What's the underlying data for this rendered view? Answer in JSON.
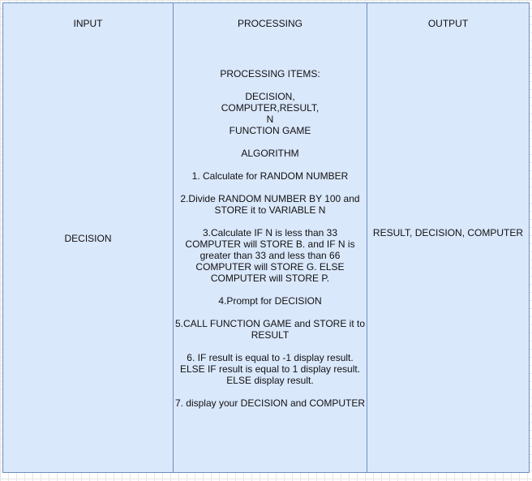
{
  "headers": {
    "input": "INPUT",
    "processing": "PROCESSING",
    "output": "OUTPUT"
  },
  "input": {
    "text": "DECISION"
  },
  "output": {
    "text": "RESULT, DECISION, COMPUTER"
  },
  "processing": {
    "lines": [
      "PROCESSING ITEMS:",
      "",
      "DECISION,",
      "COMPUTER,RESULT,",
      "N",
      "FUNCTION GAME",
      "",
      "ALGORITHM",
      "",
      "1. Calculate for RANDOM NUMBER",
      "",
      "2.Divide RANDOM NUMBER BY 100 and",
      "STORE it to VARIABLE N",
      "",
      "3.Calculate IF N is less than 33",
      "COMPUTER will STORE B. and IF N is",
      "greater than 33 and less than 66",
      "COMPUTER will STORE G. ELSE",
      "COMPUTER will STORE P.",
      "",
      "4.Prompt for DECISION",
      "",
      "5.CALL FUNCTION GAME and STORE it to",
      "RESULT",
      "",
      "6. IF result is equal to -1 display result.",
      "ELSE IF result is equal to 1 display result.",
      "ELSE display result.",
      "",
      "7. display your DECISION and COMPUTER"
    ]
  }
}
